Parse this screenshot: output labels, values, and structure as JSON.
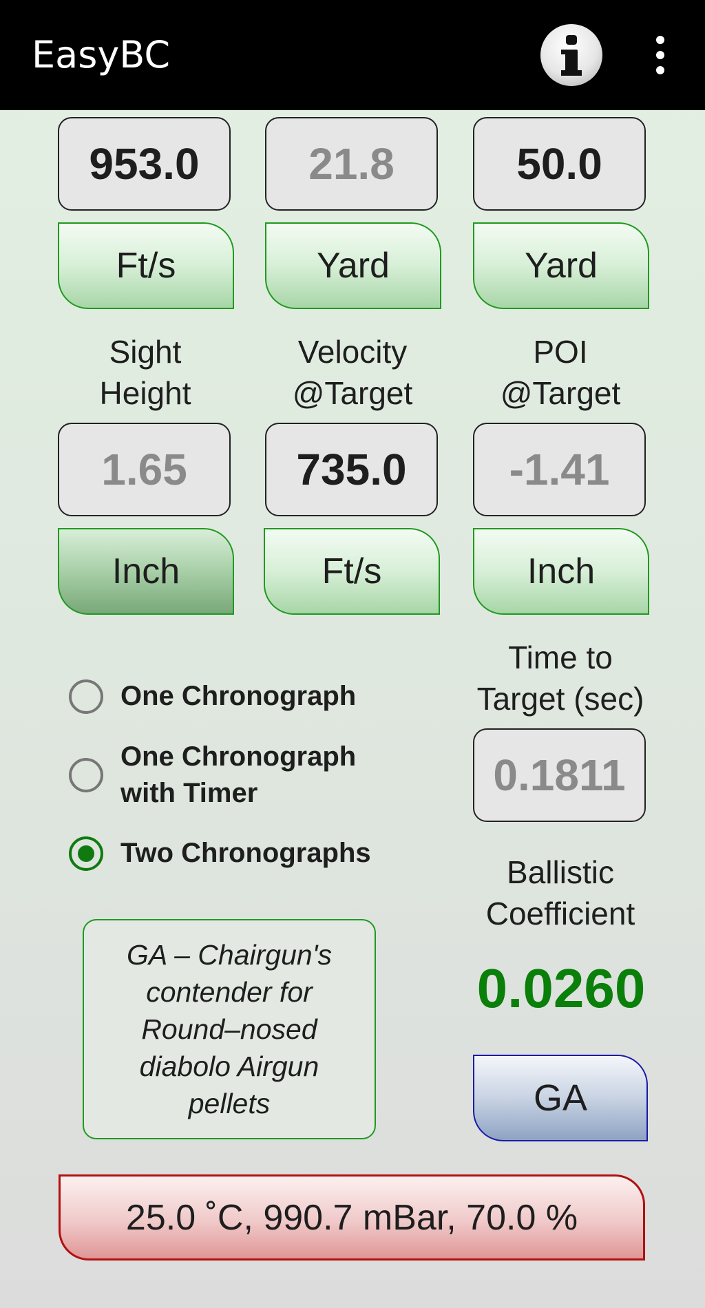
{
  "app": {
    "title": "EasyBC"
  },
  "icons": {
    "info": "info-icon",
    "overflow_menu": "more-vert-icon"
  },
  "row1": {
    "values": [
      "953.0",
      "21.8",
      "50.0"
    ],
    "units": [
      "Ft/s",
      "Yard",
      "Yard"
    ]
  },
  "labels": {
    "sight_height": [
      "Sight",
      "Height"
    ],
    "velocity_target": [
      "Velocity",
      "@Target"
    ],
    "poi_target": [
      "POI",
      "@Target"
    ],
    "time_to_target": [
      "Time to",
      "Target (sec)"
    ],
    "ballistic_coefficient": [
      "Ballistic",
      "Coefficient"
    ]
  },
  "row2": {
    "values": [
      "1.65",
      "735.0",
      "-1.41"
    ],
    "units": [
      "Inch",
      "Ft/s",
      "Inch"
    ]
  },
  "mode": {
    "options": [
      {
        "label_lines": [
          "One Chronograph"
        ],
        "selected": false
      },
      {
        "label_lines": [
          "One Chronograph",
          "with Timer"
        ],
        "selected": false
      },
      {
        "label_lines": [
          "Two Chronographs"
        ],
        "selected": true
      }
    ]
  },
  "time_to_target": "0.1811",
  "description_lines": [
    "GA – Chairgun's",
    "contender for",
    "Round–nosed",
    "diabolo Airgun",
    "pellets"
  ],
  "bc_value": "0.0260",
  "drag_model_button": "GA",
  "environment": "25.0 ˚C, 990.7 mBar, 70.0 %",
  "colors": {
    "accent_green": "#1f9a1f",
    "bc_value_green": "#0a7f0a",
    "ga_button_border": "#1a1aa8",
    "environment_border": "#b01010"
  }
}
